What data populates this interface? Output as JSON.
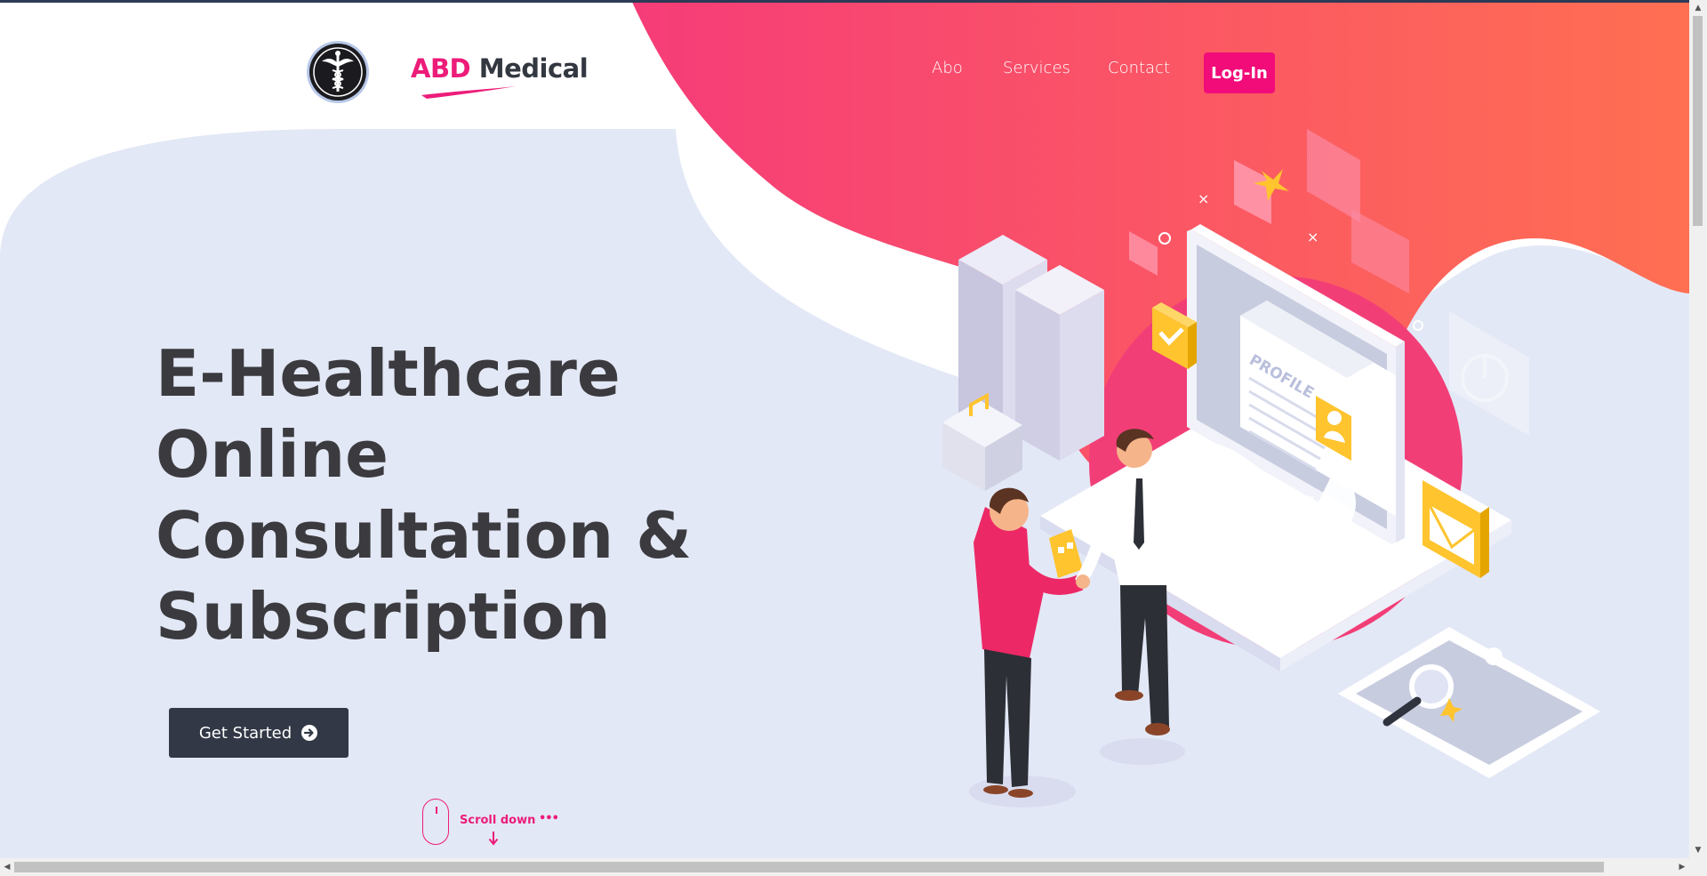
{
  "brand": {
    "part1": "ABD",
    "part2": "Medical",
    "accent": "#ec1c79"
  },
  "nav": {
    "links": [
      "Abo",
      "Services",
      "Contact"
    ],
    "login": "Log-In",
    "login_color": "#f10c79"
  },
  "hero": {
    "title_lines": [
      "E-Healthcare",
      "Online",
      "Consultation &",
      "Subscription"
    ],
    "cta": "Get Started",
    "cta_icon": "arrow-circle-right-icon",
    "scroll": "Scroll down",
    "scroll_dots": "•••"
  },
  "illustration": {
    "profile_label": "PROFILE"
  },
  "colors": {
    "background": "#e3e8f6",
    "blob_start": "#f63c78",
    "blob_end": "#ff6f52",
    "text_dark": "#3b3b3f",
    "button_dark": "#323845"
  }
}
